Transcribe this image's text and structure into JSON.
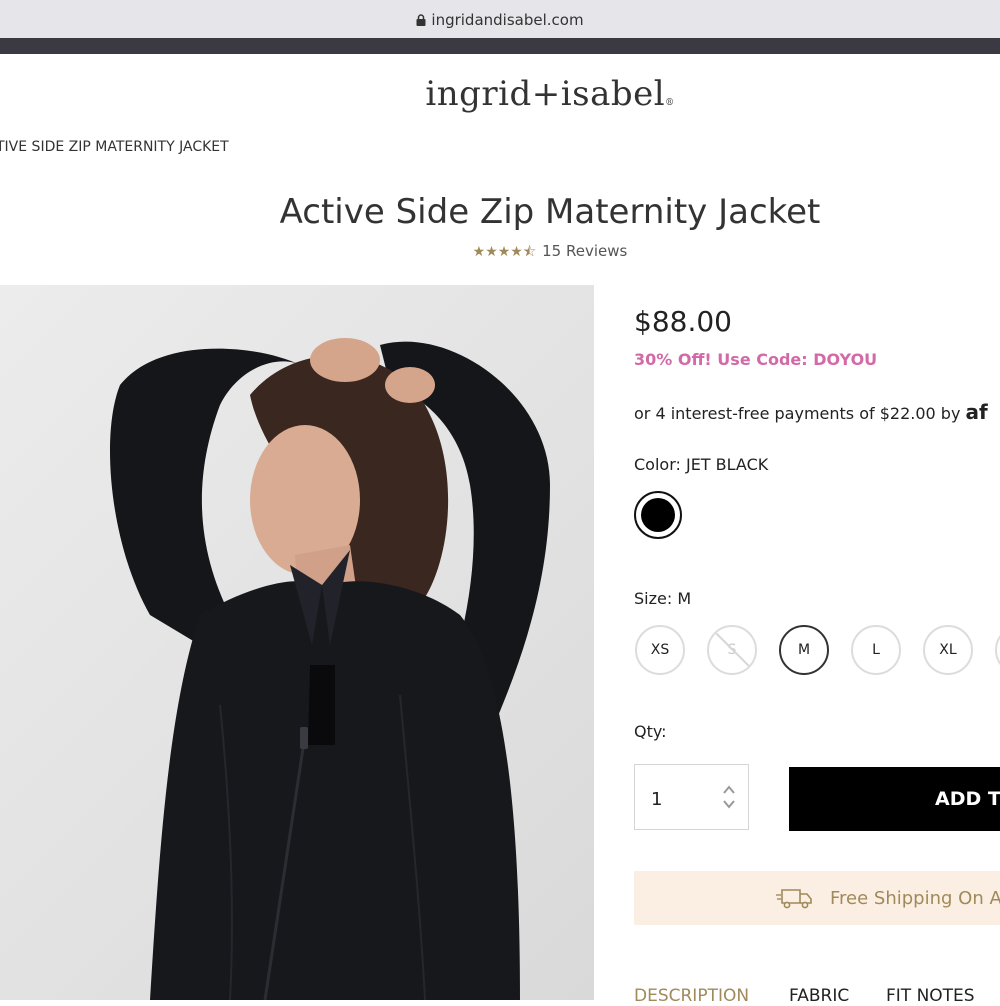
{
  "browser": {
    "url": "ingridandisabel.com"
  },
  "site": {
    "logo": "ingrid+isabel",
    "logo_mark": "®"
  },
  "breadcrumb": "TIVE SIDE ZIP MATERNITY JACKET",
  "product": {
    "title": "Active Side Zip Maternity Jacket",
    "stars": "★★★★⯪",
    "rating": 4.5,
    "reviews": "15 Reviews",
    "price": "$88.00",
    "promo": "30% Off! Use Code: DOYOU",
    "installments": "or 4 interest-free payments of $22.00 by",
    "installments_brand": "af",
    "color_label": "Color: JET BLACK",
    "size_label": "Size: M",
    "sizes": [
      "XS",
      "S",
      "M",
      "L",
      "XL"
    ],
    "qty_label": "Qty:",
    "qty_value": "1",
    "add_to_bag": "ADD T",
    "shipping": "Free Shipping On All",
    "tabs": [
      "DESCRIPTION",
      "FABRIC",
      "FIT NOTES"
    ]
  },
  "colors": {
    "promo": "#d36aa7",
    "accent": "#a08a5a",
    "banner": "#fbefe4"
  }
}
